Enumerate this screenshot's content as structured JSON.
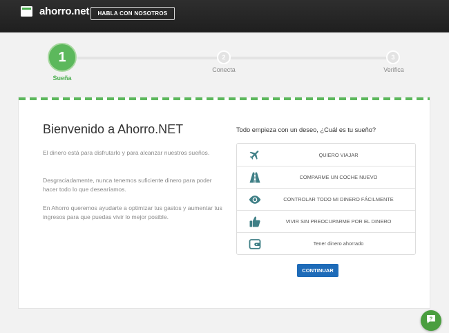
{
  "header": {
    "logo_text": "ahorro.net",
    "cta_label": "HABLA CON NOSOTROS"
  },
  "steps": [
    {
      "number": "1",
      "label": "Sueña",
      "active": true
    },
    {
      "number": "2",
      "label": "Conecta",
      "active": false
    },
    {
      "number": "3",
      "label": "Verifica",
      "active": false
    }
  ],
  "intro": {
    "title": "Bienvenido a Ahorro.NET",
    "paragraphs": [
      "El dinero está para disfrutarlo y para alcanzar nuestros sueños.",
      "Desgraciadamente, nunca tenemos suficiente dinero para poder hacer todo lo que desearíamos.",
      "En Ahorro queremos ayudarte a optimizar tus gastos y aumentar tus ingresos para que puedas vivir lo mejor posible."
    ]
  },
  "dreams": {
    "question": "Todo empieza con un deseo, ¿Cuál es tu sueño?",
    "options": [
      {
        "icon": "airplane-icon",
        "label": "QUIERO VIAJAR"
      },
      {
        "icon": "road-icon",
        "label": "COMPARME UN COCHE NUEVO"
      },
      {
        "icon": "eye-icon",
        "label": "CONTROLAR TODO MI DINERO FÁCILMENTE"
      },
      {
        "icon": "thumbs-up-icon",
        "label": "VIVIR SIN PREOCUPARME POR EL DINERO"
      },
      {
        "icon": "wallet-icon",
        "label": "Tener dinero ahorrado"
      }
    ],
    "continue_label": "CONTINUAR"
  },
  "colors": {
    "brand_green": "#5cb85c",
    "icon_teal": "#3f7f86",
    "button_blue": "#1e6bb8",
    "header_dark": "#262626"
  },
  "help_icon": "help-chat-icon"
}
